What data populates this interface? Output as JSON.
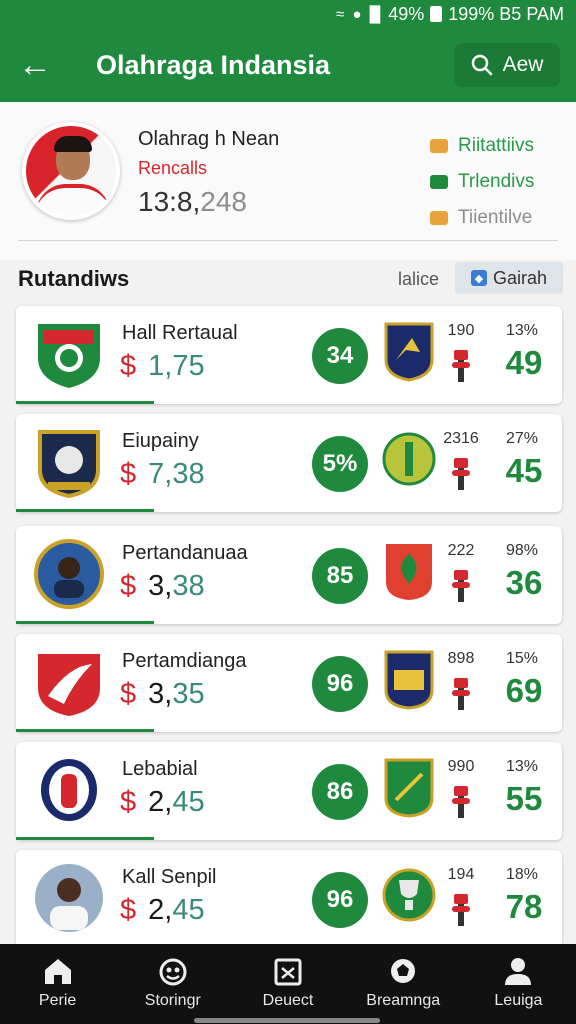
{
  "status_bar": {
    "signal_text": "49%",
    "battery_time": "199% B5 PAM"
  },
  "app_bar": {
    "title": "Olahraga Indansia",
    "search_label": "Aew"
  },
  "profile": {
    "name": "Olahrag h Nean",
    "subtitle": "Rencalls",
    "count_main": "13:8,",
    "count_rest": "248",
    "tags": [
      {
        "label": "Riitattiivs",
        "color": "#e8a23a",
        "text_color": "#2a9a4a"
      },
      {
        "label": "Trlendivs",
        "color": "#1f8a3e",
        "text_color": "#2a9a4a"
      },
      {
        "label": "Tiientilve",
        "color": "#e8a23a",
        "text_color": "#8e8e8e"
      }
    ]
  },
  "section": {
    "title": "Rutandiws",
    "link": "lalice",
    "button": "Gairah"
  },
  "teams": [
    {
      "name": "Hall Rertaual",
      "price_main": "1,75",
      "price_rest": "",
      "dark": false,
      "score": "34",
      "stat1": "190",
      "stat2": "13%",
      "big": "49",
      "crest": "crest-shield-green",
      "opponent": "opponent-crest-navy"
    },
    {
      "name": "Eiupainy",
      "price_main": "7,38",
      "price_rest": "",
      "dark": false,
      "score": "5%",
      "stat1": "2316",
      "stat2": "27%",
      "big": "45",
      "crest": "crest-navy-gold",
      "opponent": "opponent-crest-green-circle"
    },
    {
      "name": "Pertandanuaa",
      "price_main": "3,",
      "price_rest": "38",
      "dark": true,
      "score": "85",
      "stat1": "222",
      "stat2": "98%",
      "big": "36",
      "crest": "crest-blue-player",
      "opponent": "opponent-crest-red"
    },
    {
      "name": "Pertamdianga",
      "price_main": "3,",
      "price_rest": "35",
      "dark": true,
      "score": "96",
      "stat1": "898",
      "stat2": "15%",
      "big": "69",
      "crest": "crest-red-wings",
      "opponent": "opponent-crest-navy-gold"
    },
    {
      "name": "Lebabial",
      "price_main": "2,",
      "price_rest": "45",
      "dark": true,
      "score": "86",
      "stat1": "990",
      "stat2": "13%",
      "big": "55",
      "crest": "crest-navy-red",
      "opponent": "opponent-crest-green"
    },
    {
      "name": "Kall Senpil",
      "price_main": "2,",
      "price_rest": "45",
      "dark": true,
      "score": "96",
      "stat1": "194",
      "stat2": "18%",
      "big": "78",
      "crest": "crest-player-photo",
      "opponent": "opponent-crest-trophy"
    }
  ],
  "nav": [
    {
      "label": "Perie",
      "icon": "home-icon"
    },
    {
      "label": "Storingr",
      "icon": "games-icon"
    },
    {
      "label": "Deuect",
      "icon": "ticket-icon"
    },
    {
      "label": "Breamnga",
      "icon": "ball-icon"
    },
    {
      "label": "Leuiga",
      "icon": "profile-icon"
    }
  ]
}
